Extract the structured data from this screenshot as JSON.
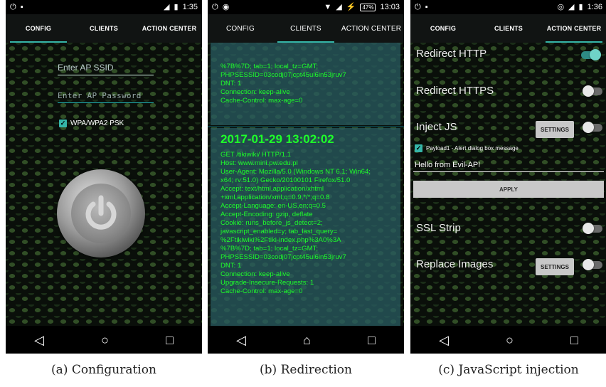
{
  "phones": {
    "config": {
      "status": {
        "time": "1:35"
      },
      "tabs": [
        "CONFIG",
        "CLIENTS",
        "ACTION CENTER"
      ],
      "ssid_placeholder": "Enter AP SSID",
      "password_placeholder": "Enter AP Password",
      "wpa_label": "WPA/WPA2 PSK",
      "caption": "(a) Configuration"
    },
    "clients": {
      "status": {
        "time": "13:03",
        "battery": "47%"
      },
      "tabs": [
        "CONFIG",
        "CLIENTS",
        "ACTION CENTER"
      ],
      "prev_entry": [
        "%7B%7D; tab=1; local_tz=GMT;",
        "PHPSESSID=03codj07jcpt45ul6in53jruv7",
        "DNT: 1",
        "Connection: keep-alive",
        "Cache-Control: max-age=0"
      ],
      "timestamp": "2017-01-29 13:02:02",
      "entry": [
        "GET /tikiwiki/ HTTP/1.1",
        "Host: www.mini.pw.edu.pl",
        "User-Agent: Mozilla/5.0 (Windows NT 6.1; Win64;",
        "x64; rv:51.0) Gecko/20100101 Firefox/51.0",
        "Accept: text/html,application/xhtml",
        "+xml,application/xml;q=0.9,*/*;q=0.8",
        "Accept-Language: en-US,en;q=0.5",
        "Accept-Encoding: gzip, deflate",
        "Cookie: runs_before_js_detect=2;",
        "javascript_enabled=y; tab_last_query=",
        "%2Ftikiwiki%2Ftiki-index.php%3A0%3A",
        "%7B%7D; tab=1; local_tz=GMT;",
        "PHPSESSID=03codj07jcpt45ul6in53jruv7",
        "DNT: 1",
        "Connection: keep-alive",
        "Upgrade-Insecure-Requests: 1",
        "Cache-Control: max-age=0"
      ],
      "caption": "(b) Redirection"
    },
    "action": {
      "status": {
        "time": "1:36"
      },
      "tabs": [
        "CONFIG",
        "CLIENTS",
        "ACTION CENTER"
      ],
      "redirect_http": "Redirect HTTP",
      "redirect_https": "Redirect HTTPS",
      "inject_js": "Inject JS",
      "settings_label": "SETTINGS",
      "payload_label": "Payload1 - Alert dialog box message",
      "message_value": "Hello from Evil-AP!",
      "apply_label": "APPLY",
      "ssl_strip": "SSL Strip",
      "replace_images": "Replace Images",
      "toggles": {
        "redirect_http": true,
        "redirect_https": false,
        "inject_js": false,
        "ssl_strip": false,
        "replace_images": false
      },
      "caption": "(c) JavaScript injection"
    }
  },
  "colors": {
    "accent": "#35b5a8",
    "log_text": "#1eff2a"
  }
}
